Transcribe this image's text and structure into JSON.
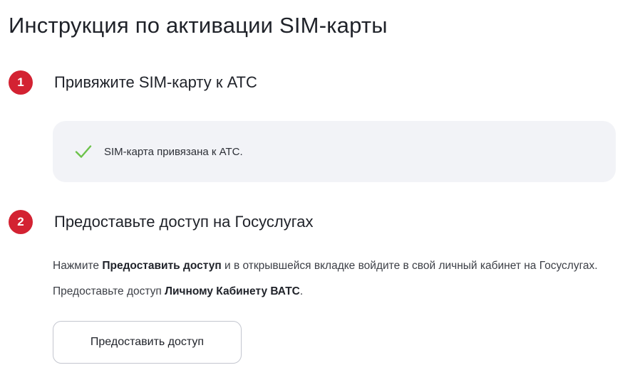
{
  "page": {
    "title": "Инструкция по активации SIM-карты"
  },
  "steps": [
    {
      "number": "1",
      "title": "Привяжите SIM-карту к АТС",
      "status": {
        "icon": "check-icon",
        "icon_color": "#6cc24a",
        "text": "SIM-карта привязана к АТС."
      }
    },
    {
      "number": "2",
      "title": "Предоставьте доступ на Госуслугах",
      "instructions": {
        "part1": "Нажмите ",
        "bold1": "Предоставить доступ",
        "part2": " и в открывшейся вкладке войдите в свой личный кабинет на Госуслугах. Предоставьте доступ ",
        "bold2": "Личному Кабинету ВАТС",
        "part3": "."
      },
      "button_label": "Предоставить доступ"
    }
  ],
  "colors": {
    "badge": "#d32232",
    "status_box_bg": "#f2f3f7",
    "text": "#1f2229"
  }
}
